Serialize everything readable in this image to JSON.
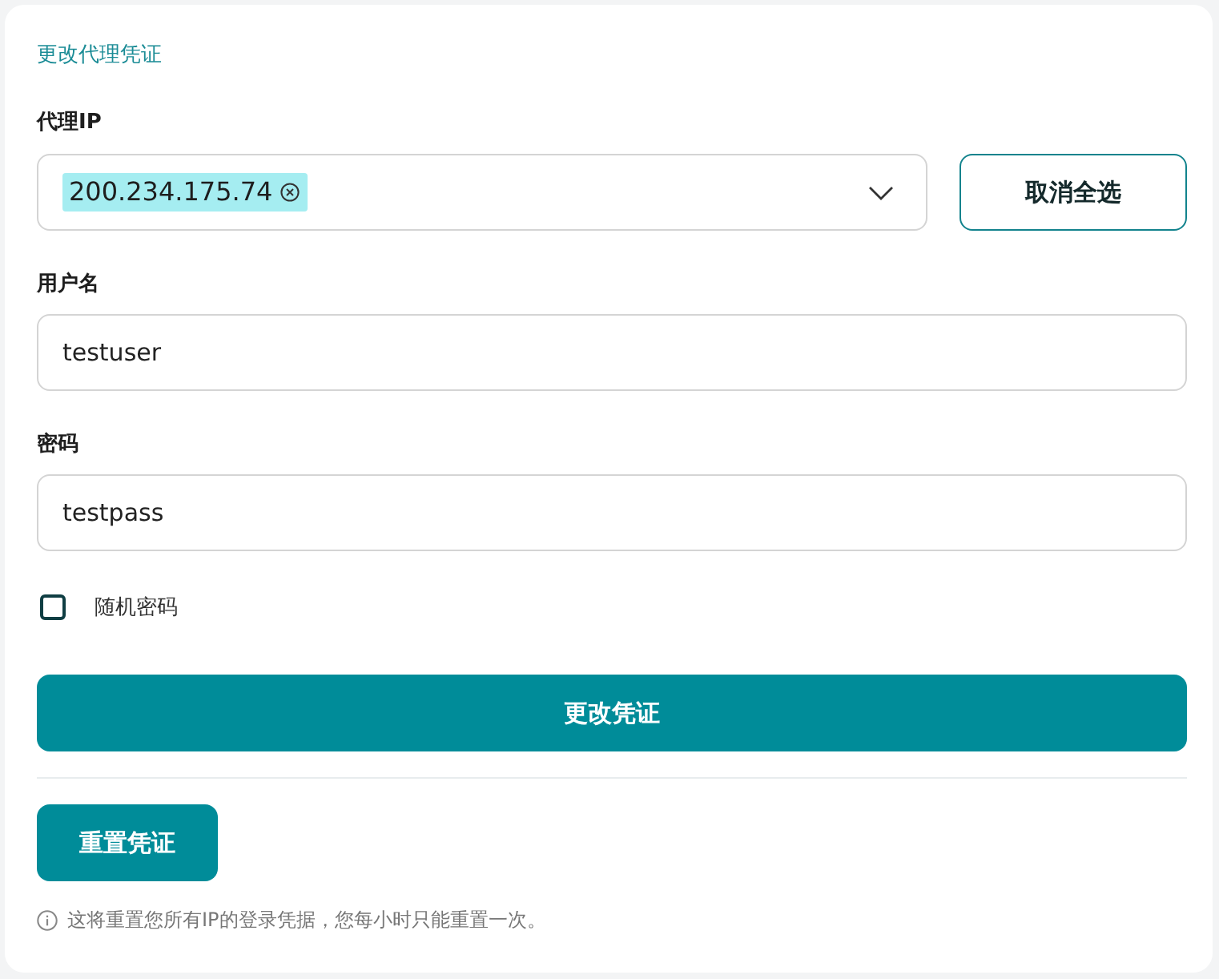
{
  "card": {
    "title": "更改代理凭证"
  },
  "proxy_ip": {
    "label": "代理IP",
    "selected_ips": [
      {
        "label": "200.234.175.74"
      }
    ],
    "deselect_all_button": "取消全选"
  },
  "username": {
    "label": "用户名",
    "value": "testuser"
  },
  "password": {
    "label": "密码",
    "value": "testpass"
  },
  "random_password": {
    "label": "随机密码",
    "checked": false
  },
  "change_button": "更改凭证",
  "reset_button": "重置凭证",
  "note": "这将重置您所有IP的登录凭据，您每小时只能重置一次。"
}
